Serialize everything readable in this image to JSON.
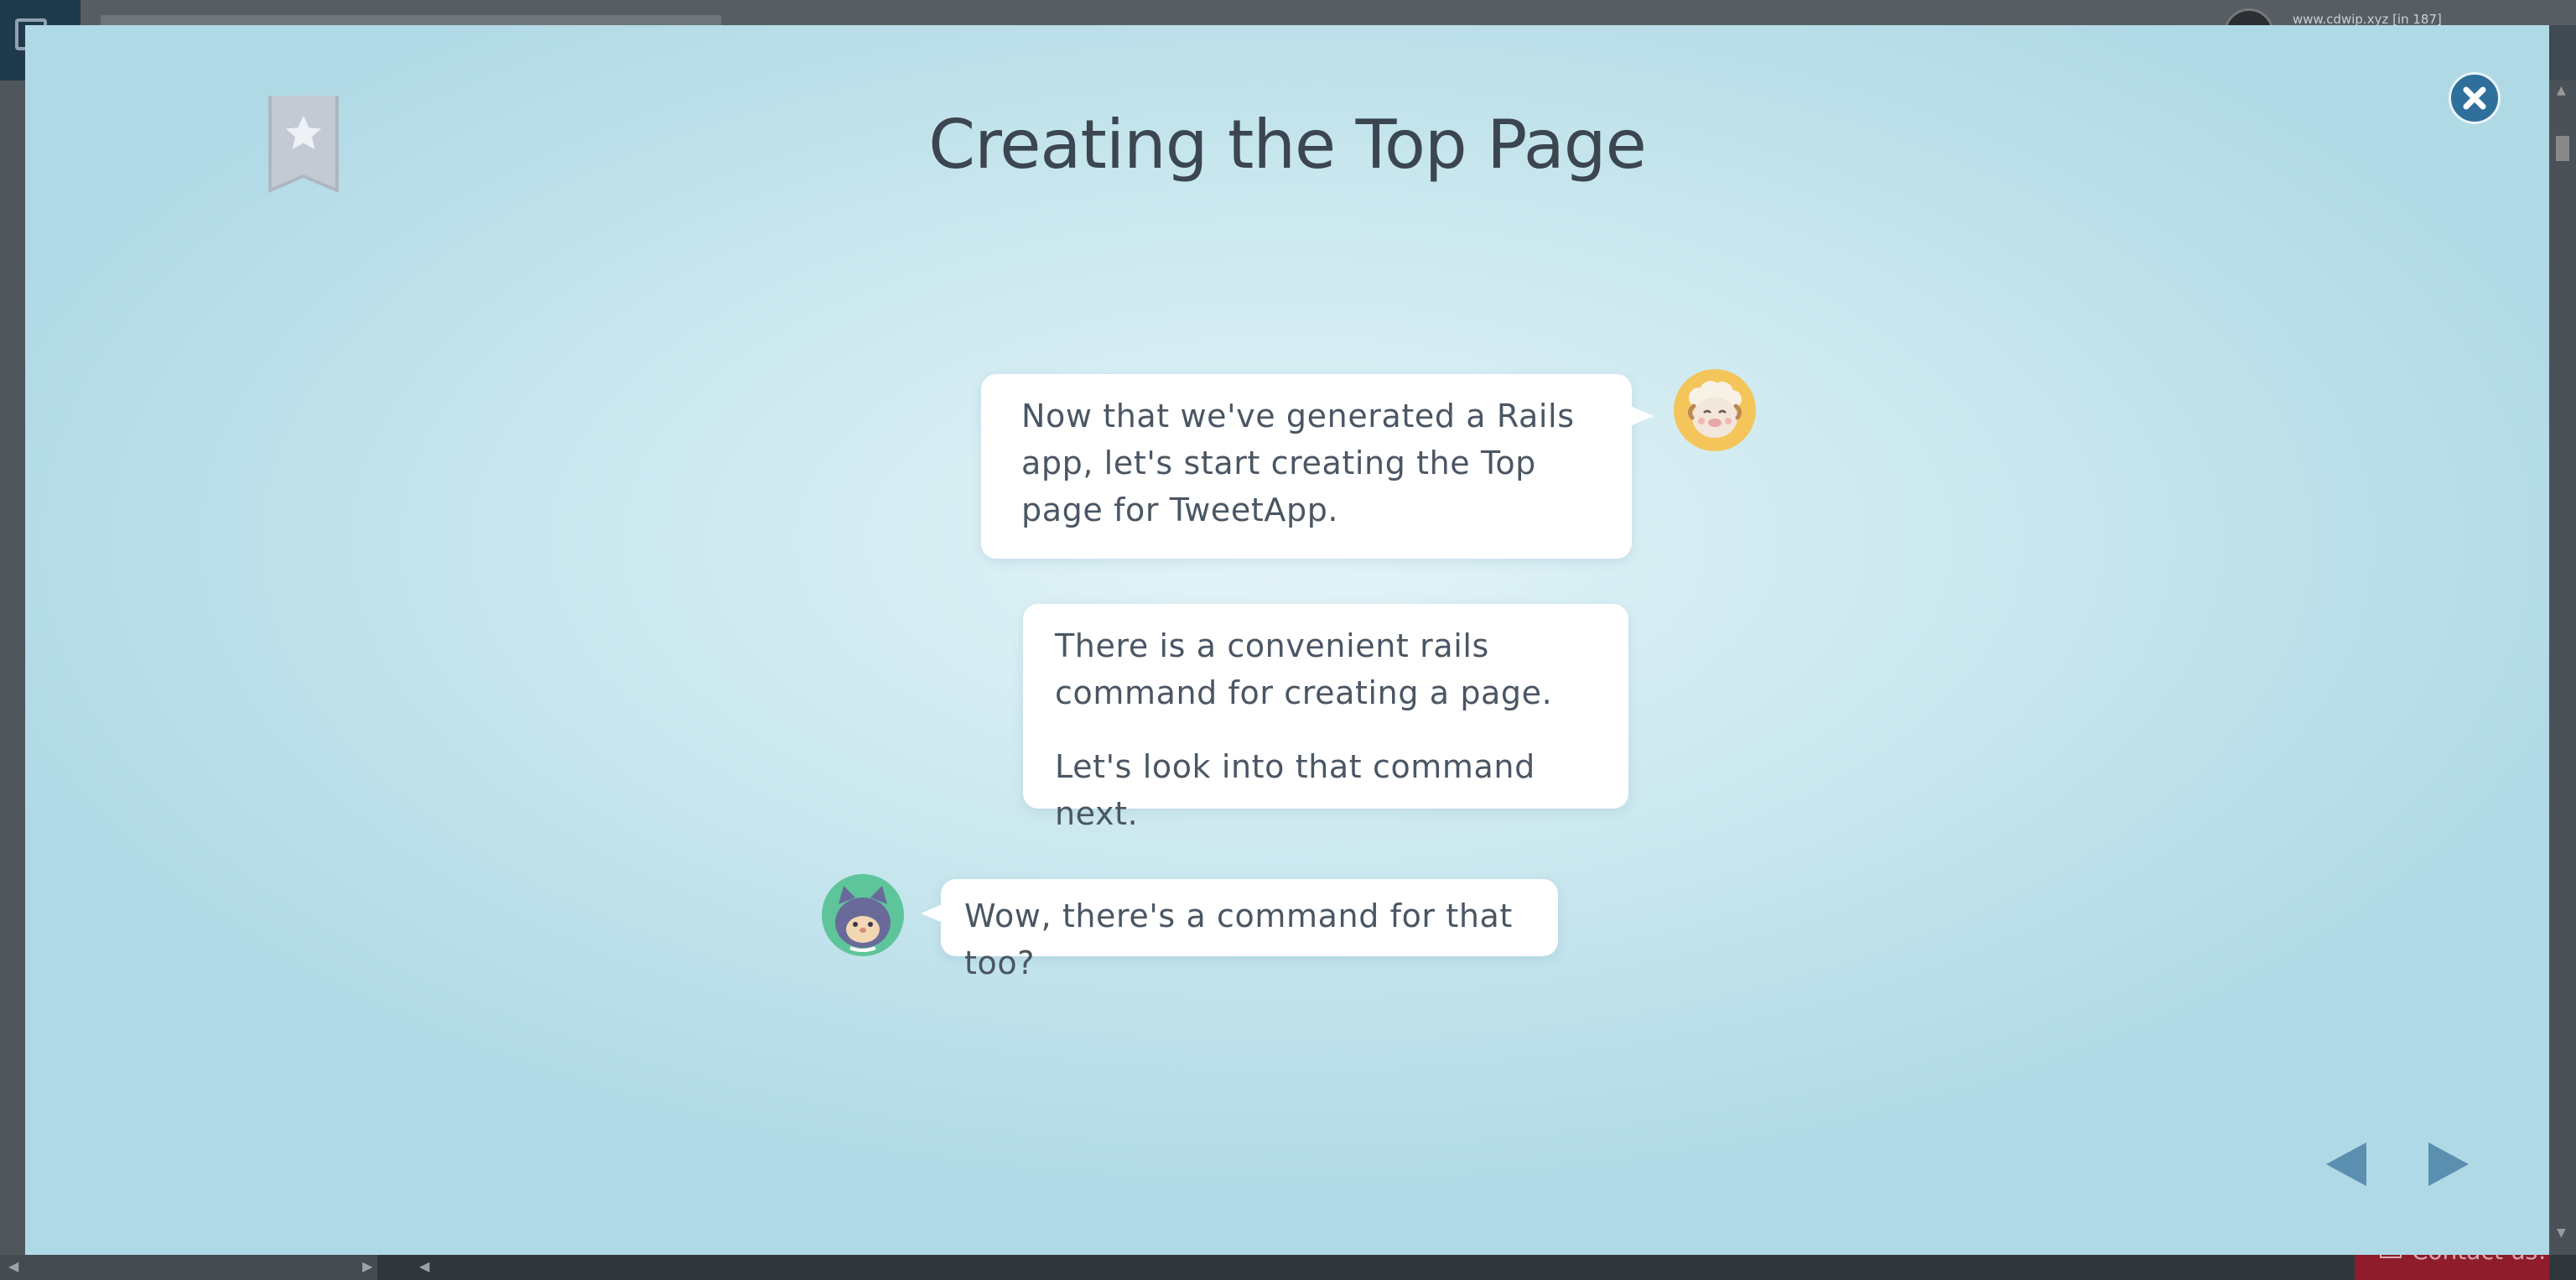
{
  "background_app": {
    "user_label": "www.cdwip.xyz [in 187]",
    "contact_label": "Contact us!"
  },
  "modal": {
    "title": "Creating the Top Page",
    "conversation": [
      {
        "speaker_icon": "sheep-avatar-icon",
        "paragraphs": [
          "Now that we've generated a Rails app, let's start creating the Top page for TweetApp."
        ]
      },
      {
        "speaker_icon": "sheep-avatar-icon",
        "paragraphs": [
          "There is a convenient rails command for creating a page.",
          "Let's look into that command next."
        ]
      },
      {
        "speaker_icon": "cat-avatar-icon",
        "paragraphs": [
          "Wow, there's a command for that too?"
        ]
      }
    ]
  },
  "colors": {
    "close_button": "#2f6f9c",
    "nav_arrows": "#5b8fb0",
    "bookmark": "#b9c1cc",
    "text": "#4a5663",
    "title": "#3c4650"
  }
}
